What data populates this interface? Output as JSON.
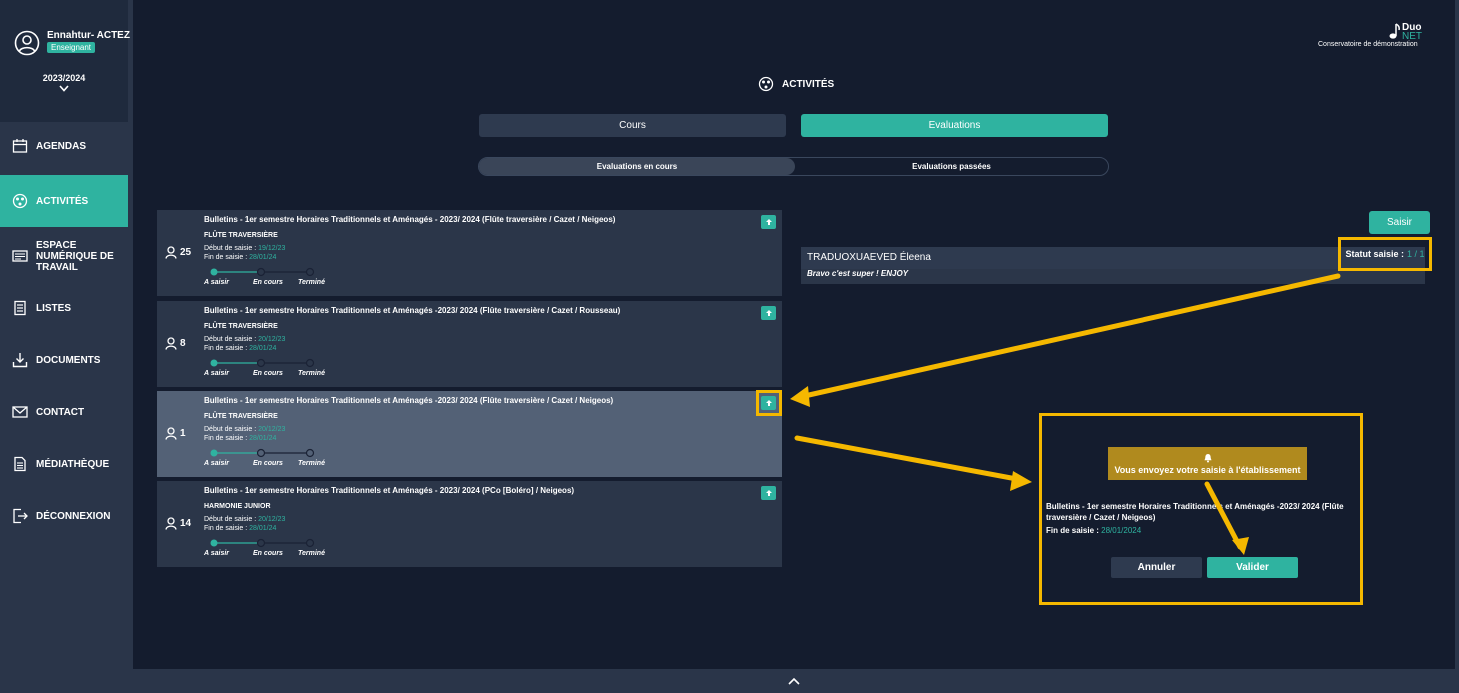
{
  "user": {
    "name": "Ennahtur- ACTEZ",
    "role": "Enseignant",
    "year": "2023/2024"
  },
  "nav": [
    {
      "label": "AGENDAS",
      "icon": "calendar-icon"
    },
    {
      "label": "ACTIVITÉS",
      "icon": "activities-icon",
      "active": true
    },
    {
      "label": "ESPACE NUMÉRIQUE DE TRAVAIL",
      "icon": "workspace-icon"
    },
    {
      "label": "LISTES",
      "icon": "list-icon"
    },
    {
      "label": "DOCUMENTS",
      "icon": "download-icon"
    },
    {
      "label": "CONTACT",
      "icon": "mail-icon"
    },
    {
      "label": "MÉDIATHÈQUE",
      "icon": "document-icon"
    },
    {
      "label": "DÉCONNEXION",
      "icon": "logout-icon"
    }
  ],
  "logo": {
    "duo": "Duo",
    "net": "NET",
    "subtitle": "Conservatoire de démonstration"
  },
  "page_title": "ACTIVITÉS",
  "tabs": {
    "cours": "Cours",
    "evaluations": "Evaluations"
  },
  "subtabs": {
    "current": "Evaluations en cours",
    "past": "Evaluations passées"
  },
  "cards": [
    {
      "title": "Bulletins - 1er semestre Horaires Traditionnels et Aménagés - 2023/ 2024 (Flûte traversière / Cazet / Neigeos)",
      "instrument": "FLÛTE TRAVERSIÈRE",
      "count": "25",
      "start_label": "Début de saisie :",
      "start": "19/12/23",
      "end_label": "Fin de saisie :",
      "end": "28/01/24"
    },
    {
      "title": "Bulletins - 1er semestre Horaires Traditionnels et Aménagés -2023/ 2024 (Flûte traversière / Cazet / Rousseau)",
      "instrument": "FLÛTE TRAVERSIÈRE",
      "count": "8",
      "start_label": "Début de saisie :",
      "start": "20/12/23",
      "end_label": "Fin de saisie :",
      "end": "28/01/24"
    },
    {
      "title": "Bulletins - 1er semestre Horaires Traditionnels et Aménagés -2023/ 2024 (Flûte traversière / Cazet / Neigeos)",
      "instrument": "FLÛTE TRAVERSIÈRE",
      "count": "1",
      "start_label": "Début de saisie :",
      "start": "20/12/23",
      "end_label": "Fin de saisie :",
      "end": "28/01/24"
    },
    {
      "title": "Bulletins - 1er semestre Horaires Traditionnels et Aménagés - 2023/ 2024 (PCo [Boléro] / Neigeos)",
      "instrument": "HARMONIE JUNIOR",
      "count": "14",
      "start_label": "Début de saisie :",
      "start": "20/12/23",
      "end_label": "Fin de saisie :",
      "end": "28/01/24"
    }
  ],
  "progress_labels": [
    "A saisir",
    "En cours",
    "Terminé"
  ],
  "saisir_label": "Saisir",
  "student": {
    "name": "TRADUOXUAEVED Éleena",
    "comment": "Bravo c'est super ! ENJOY",
    "status_label": "Statut saisie :",
    "status_value": "1 / 1"
  },
  "modal": {
    "message": "Vous envoyez votre saisie à l'établissement",
    "title": "Bulletins - 1er semestre Horaires Traditionnels et Aménagés -2023/ 2024 (Flûte traversière / Cazet / Neigeos)",
    "fin_label": "Fin de saisie :",
    "fin_value": "28/01/2024",
    "cancel": "Annuler",
    "confirm": "Valider"
  },
  "colors": {
    "accent": "#2fb3a0",
    "highlight": "#f5b800",
    "sidebar": "#2a3549",
    "background": "#141c2e"
  }
}
